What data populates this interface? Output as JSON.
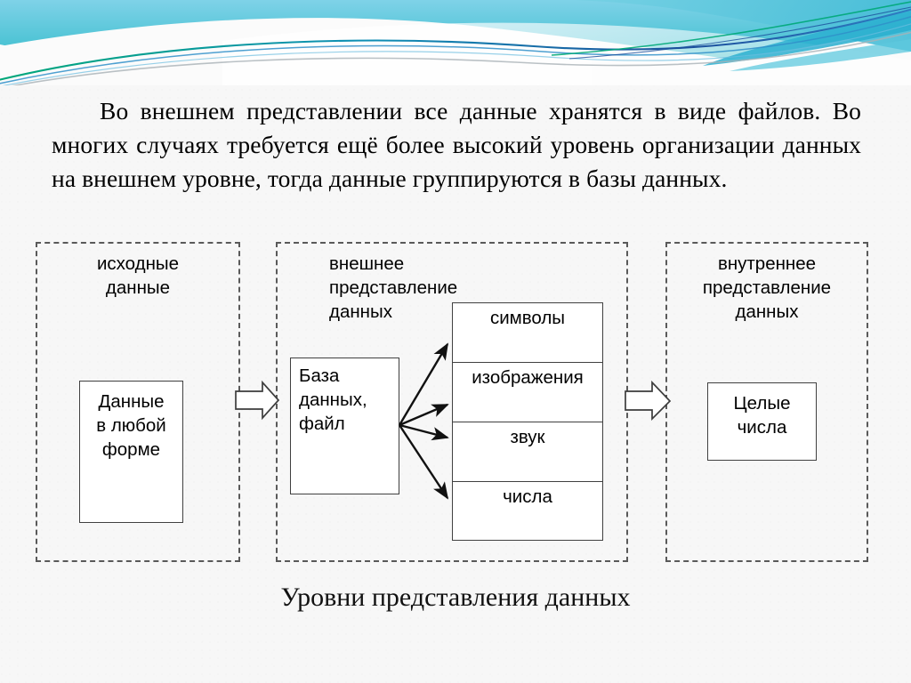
{
  "slide": {
    "paragraph": "Во внешнем представлении все данные хранятся в виде файлов. Во многих случаях требуется ещё более высокий уровень организации данных на внешнем уровне, тогда данные группируются в базы данных.",
    "caption": "Уровни представления данных"
  },
  "diagram": {
    "panels": [
      {
        "id": "source",
        "title": "исходные\nданные"
      },
      {
        "id": "external",
        "title": "внешнее\nпредставление\nданных"
      },
      {
        "id": "internal",
        "title": "внутреннее\nпредставление\nданных"
      }
    ],
    "boxes": {
      "any_form": "Данные\nв любой\nформе",
      "db_file": "База\nданных,\nфайл",
      "integers": "Целые\nчисла"
    },
    "stack": [
      {
        "label": "символы"
      },
      {
        "label": "изображения"
      },
      {
        "label": "звук"
      },
      {
        "label": "числа"
      }
    ],
    "flow_arrow_count": 2,
    "branch_arrow_count": 4
  },
  "colors": {
    "background": "#f7f7f7",
    "text": "#000000",
    "box_border": "#404040",
    "panel_border": "#5a5a5a",
    "banner_cyan": "#57c8dd",
    "banner_teal": "#35b6c4",
    "banner_green": "#00a878",
    "banner_navy": "#1b4f9c",
    "banner_gray": "#9aa0a6"
  }
}
